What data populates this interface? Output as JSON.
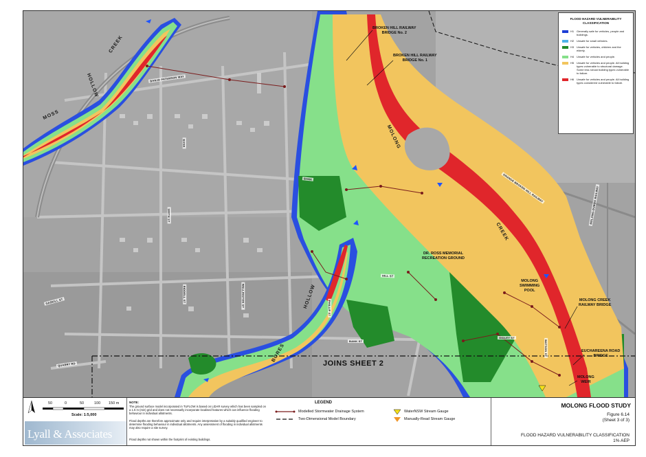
{
  "map": {
    "place_labels": {
      "broken_hill_bridge_2": [
        "BROKEN HILL RAILWAY",
        "BRIDGE No. 2"
      ],
      "broken_hill_bridge_1": [
        "BROKEN HILL RAILWAY",
        "BRIDGE No. 1"
      ],
      "dr_ross": [
        "DR. ROSS MEMORIAL",
        "RECREATION GROUND"
      ],
      "swimming_pool": [
        "MOLONG",
        "SWIMMING",
        "POOL"
      ],
      "creek_railway_bridge": [
        "MOLONG CREEK",
        "RAILWAY BRIDGE"
      ],
      "euchareena_bridge": [
        "EUCHAREENA ROAD",
        "BRIDGE"
      ],
      "molong_weir": [
        "MOLONG",
        "WEIR"
      ]
    },
    "creek_labels": {
      "creek_nw": "CREEK",
      "hollow_nw": "HOLLOW",
      "moss": "MOSS",
      "molong": "MOLONG",
      "creek_main": "CREEK",
      "hollow_s": "HOLLOW",
      "bores": "BORES"
    },
    "street_labels": {
      "bank": "BANK",
      "bank2": "BANK",
      "smith": "SMITH ST",
      "hill": "HILL ST",
      "gaskill": "GASKILL ST",
      "quarry": "QUARRY RD",
      "riddell": "RIDDELL ST",
      "wellington": "WELLINGTON ST",
      "phillip": "PHILLIP ST",
      "bank3": "BANK ST",
      "gidley": "GIDLEY ST",
      "watson": "WATSON ST",
      "orange_bh_railway": "ORANGE-BROKEN HILL RAILWAY",
      "molong_dubbo": "MOLONG-DUBBO RAILWAY",
      "banjo": "BANJO PATERSON WAY"
    },
    "joins_sheet": "JOINS SHEET 2"
  },
  "hazard_legend": {
    "title": [
      "FLOOD HAZARD VULNERABILITY",
      "CLASSIFICATION"
    ],
    "classes": [
      {
        "code": "H1",
        "color": "#1d3fd6",
        "desc": "Generally safe for vehicles, people and buildings."
      },
      {
        "code": "H2",
        "color": "#4fb3e8",
        "desc": "Unsafe for small vehicles."
      },
      {
        "code": "H3",
        "color": "#238b2b",
        "desc": "Unsafe for vehicles, children and the elderly."
      },
      {
        "code": "H4",
        "color": "#86e08a",
        "desc": "Unsafe for vehicles and people."
      },
      {
        "code": "H5",
        "color": "#f2c55e",
        "desc": "Unsafe for vehicles and people. All building types vulnerable to structural damage. Some less robust building types vulnerable to failure."
      },
      {
        "code": "H6",
        "color": "#e0262b",
        "desc": "Unsafe for vehicles and people. All building types considered vulnerable to failure."
      }
    ]
  },
  "footer": {
    "north_symbol": "north-arrow-icon",
    "scale_ticks": [
      "50",
      "0",
      "50",
      "100",
      "150 m"
    ],
    "scale_label": "Scale: 1:5,000",
    "logo_text": "Lyall & Associates",
    "note_heading": "NOTE:",
    "notes": [
      "The ground surface model incorporated in TUFLOW is based on LiDAR survey which has been sampled on a 1.5 m (min) grid and does not necessarily incorporate localised features which can influence flooding behaviour in individual allotments.",
      "Flood depths are therefore approximate only and require interpretation by a suitably qualified engineer to determine flooding behaviour in individual allotments. Any assessment of flooding in individual allotments may also require a site survey.",
      "Flood depths not shown within the footprint of existing buildings."
    ],
    "legend_heading": "LEGEND",
    "legend_items": [
      {
        "label": "Modelled Stormwater Drainage System",
        "icon": "drainage-line-icon",
        "color": "#7a1c1c"
      },
      {
        "label": "Two-Dimensional Model Boundary",
        "icon": "dashed-boundary-icon",
        "color": "#111111"
      },
      {
        "label": "WaterNSW Stream Gauge",
        "icon": "yellow-triangle-icon",
        "color": "#f5e11a"
      },
      {
        "label": "Manually-Read Stream Gauge",
        "icon": "orange-triangle-icon",
        "color": "#f0962a"
      }
    ],
    "study_title": "MOLONG FLOOD STUDY",
    "figure_number": "Figure 6.14",
    "figure_sheet": "(Sheet 3 of 3)",
    "figure_title": "FLOOD HAZARD VULNERABILITY CLASSIFICATION",
    "figure_aep": "1% AEP"
  }
}
